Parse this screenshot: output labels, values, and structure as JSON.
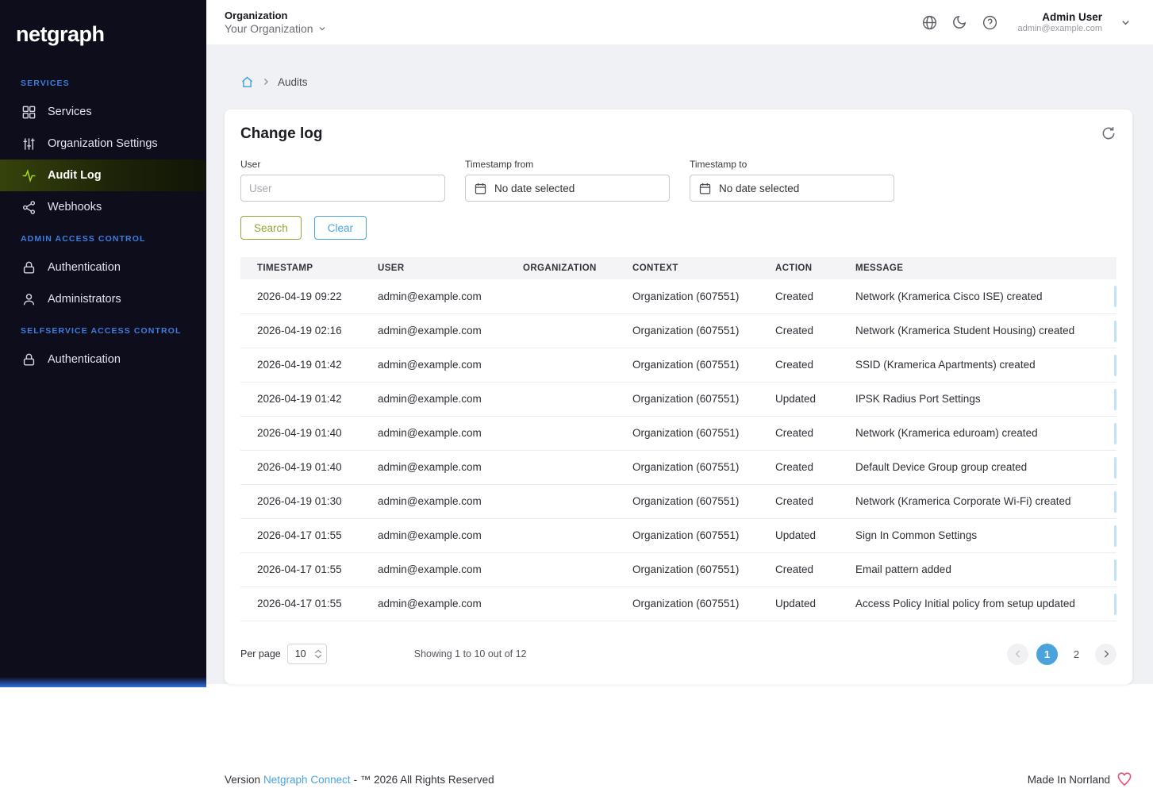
{
  "colors": {
    "accent_blue": "#4aa3dc",
    "accent_olive": "#97a436",
    "accent_green": "#a3d21d",
    "section_label_blue": "#3f7de0",
    "sidebar_bg": "#0d0d1b",
    "heart_pink": "#e8537a"
  },
  "sidebar": {
    "logo": "netgraph",
    "sections": [
      {
        "label": "SERVICES",
        "items": [
          {
            "label": "Services",
            "icon": "grid-icon",
            "active": false
          },
          {
            "label": "Organization Settings",
            "icon": "sliders-icon",
            "active": false
          },
          {
            "label": "Audit Log",
            "icon": "activity-icon",
            "active": true
          },
          {
            "label": "Webhooks",
            "icon": "share-icon",
            "active": false
          }
        ]
      },
      {
        "label": "ADMIN ACCESS CONTROL",
        "items": [
          {
            "label": "Authentication",
            "icon": "lock-icon",
            "active": false
          },
          {
            "label": "Administrators",
            "icon": "user-icon",
            "active": false
          }
        ]
      },
      {
        "label": "SELFSERVICE ACCESS CONTROL",
        "items": [
          {
            "label": "Authentication",
            "icon": "lock-icon",
            "active": false
          }
        ]
      }
    ]
  },
  "header": {
    "org_label": "Organization",
    "org_value": "Your Organization",
    "user_name": "Admin User",
    "user_email": "admin@example.com"
  },
  "breadcrumb": {
    "current": "Audits"
  },
  "changelog": {
    "title": "Change log",
    "filters": {
      "user_label": "User",
      "user_placeholder": "User",
      "user_value": "",
      "from_label": "Timestamp from",
      "from_value": "No date selected",
      "to_label": "Timestamp to",
      "to_value": "No date selected"
    },
    "buttons": {
      "search": "Search",
      "clear": "Clear"
    },
    "table": {
      "headers": [
        "Timestamp",
        "User",
        "Organization",
        "Context",
        "Action",
        "Message"
      ],
      "rows": [
        {
          "timestamp": "2026-04-19 09:22",
          "user": "admin@example.com",
          "organization": "",
          "context": "Organization (607551)",
          "action": "Created",
          "message": "Network (Kramerica Cisco ISE) created"
        },
        {
          "timestamp": "2026-04-19 02:16",
          "user": "admin@example.com",
          "organization": "",
          "context": "Organization (607551)",
          "action": "Created",
          "message": "Network (Kramerica Student Housing) created"
        },
        {
          "timestamp": "2026-04-19 01:42",
          "user": "admin@example.com",
          "organization": "",
          "context": "Organization (607551)",
          "action": "Created",
          "message": "SSID (Kramerica Apartments) created"
        },
        {
          "timestamp": "2026-04-19 01:42",
          "user": "admin@example.com",
          "organization": "",
          "context": "Organization (607551)",
          "action": "Updated",
          "message": "IPSK Radius Port Settings"
        },
        {
          "timestamp": "2026-04-19 01:40",
          "user": "admin@example.com",
          "organization": "",
          "context": "Organization (607551)",
          "action": "Created",
          "message": "Network (Kramerica eduroam) created"
        },
        {
          "timestamp": "2026-04-19 01:40",
          "user": "admin@example.com",
          "organization": "",
          "context": "Organization (607551)",
          "action": "Created",
          "message": "Default Device Group group created"
        },
        {
          "timestamp": "2026-04-19 01:30",
          "user": "admin@example.com",
          "organization": "",
          "context": "Organization (607551)",
          "action": "Created",
          "message": "Network (Kramerica Corporate Wi-Fi) created"
        },
        {
          "timestamp": "2026-04-17 01:55",
          "user": "admin@example.com",
          "organization": "",
          "context": "Organization (607551)",
          "action": "Updated",
          "message": "Sign In Common Settings"
        },
        {
          "timestamp": "2026-04-17 01:55",
          "user": "admin@example.com",
          "organization": "",
          "context": "Organization (607551)",
          "action": "Created",
          "message": "Email pattern added"
        },
        {
          "timestamp": "2026-04-17 01:55",
          "user": "admin@example.com",
          "organization": "",
          "context": "Organization (607551)",
          "action": "Updated",
          "message": "Access Policy Initial policy from setup updated"
        }
      ]
    },
    "pagination": {
      "per_page_label": "Per page",
      "per_page_value": "10",
      "showing": "Showing 1 to 10 out of 12",
      "pages": [
        "1",
        "2"
      ],
      "active_page": "1"
    }
  },
  "footer": {
    "version_label": "Version",
    "version_link": "Netgraph Connect",
    "version_rest": "- ™ 2026 All Rights Reserved",
    "made_in": "Made In Norrland"
  }
}
